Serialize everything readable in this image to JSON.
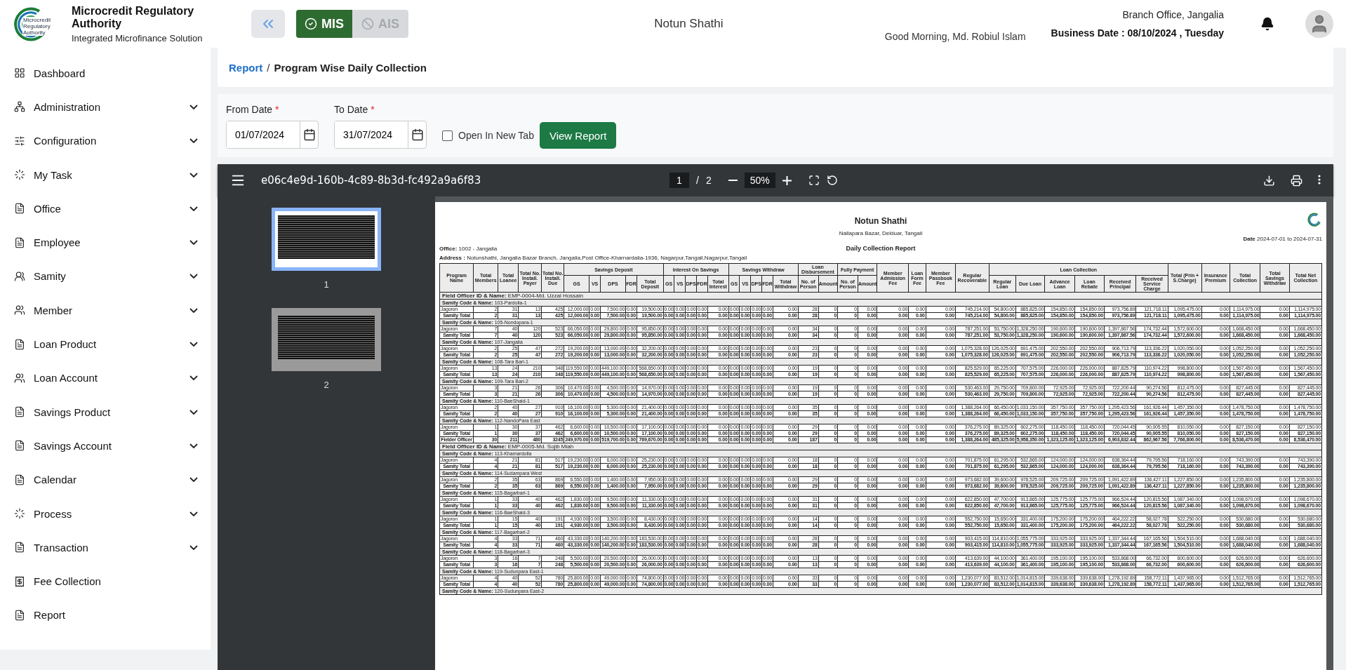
{
  "header": {
    "logo_lines": [
      "Microcredit",
      "Regulatory",
      "Authority"
    ],
    "org_name": "Microcredit Regulatory Authority",
    "org_subtitle": "Integrated Microfinance Solution",
    "modes": [
      {
        "label": "MIS",
        "selected": true
      },
      {
        "label": "AIS",
        "selected": false
      }
    ],
    "center_title": "Notun Shathi",
    "greeting": "Good Morning, Md. Robiul Islam",
    "branch": "Branch Office, Jangalia",
    "business_date": "Business Date : 08/10/2024 , Tuesday"
  },
  "sidebar": {
    "items": [
      {
        "label": "Dashboard",
        "kind": "dashboard",
        "expandable": false
      },
      {
        "label": "Administration",
        "kind": "admin",
        "expandable": true
      },
      {
        "label": "Configuration",
        "kind": "config",
        "expandable": true
      },
      {
        "label": "My Task",
        "kind": "task",
        "expandable": true
      },
      {
        "label": "Office",
        "kind": "doc",
        "expandable": true
      },
      {
        "label": "Employee",
        "kind": "doc",
        "expandable": true
      },
      {
        "label": "Samity",
        "kind": "samity",
        "expandable": true
      },
      {
        "label": "Member",
        "kind": "member",
        "expandable": true
      },
      {
        "label": "Loan Product",
        "kind": "doc",
        "expandable": true
      },
      {
        "label": "Loan Account",
        "kind": "member",
        "expandable": true
      },
      {
        "label": "Savings Product",
        "kind": "doc",
        "expandable": true
      },
      {
        "label": "Savings Account",
        "kind": "doc",
        "expandable": true
      },
      {
        "label": "Calendar",
        "kind": "doc",
        "expandable": true
      },
      {
        "label": "Process",
        "kind": "task",
        "expandable": true
      },
      {
        "label": "Transaction",
        "kind": "doc",
        "expandable": true
      },
      {
        "label": "Fee Collection",
        "kind": "fee",
        "expandable": false
      },
      {
        "label": "Report",
        "kind": "doc",
        "expandable": false
      }
    ]
  },
  "breadcrumb": {
    "link": "Report",
    "separator": "/",
    "current": "Program Wise Daily Collection"
  },
  "filters": {
    "fields": [
      {
        "label": "From Date",
        "required_mark": "*",
        "value": "01/07/2024"
      },
      {
        "label": "To Date",
        "required_mark": "*",
        "value": "31/07/2024"
      }
    ],
    "open_in_new_tab": {
      "label": "Open In New Tab",
      "checked": false
    },
    "button": "View Report"
  },
  "viewer": {
    "file_name": "e06c4e9d-160b-4c89-8b3d-fc492a9a6f83",
    "page": "1",
    "page_separator": "/",
    "page_total": "2",
    "zoom": "50%",
    "thumbnails": [
      {
        "label": "1",
        "selected": true
      },
      {
        "label": "2",
        "selected": false
      }
    ],
    "report": {
      "title": "Notun Shathi",
      "address_line": "Nallapara Bazar, Delduar, Tangail",
      "office_label": "Office:",
      "office": "1002 - Jangalia",
      "subtitle": "Daily Collection Report",
      "date_label": "Date",
      "date_range": "2024-07-01 to 2024-07-31",
      "address_label": "Address :",
      "address": "Notunshathi, Jangalia Bazar Branch, Jangalia,Post Office-Kharnardalia-1936, Nagarpur,Tangail,Nagarpur,Tangail",
      "columns": [
        {
          "label": "Program Name"
        },
        {
          "label": "Total Members"
        },
        {
          "label": "Total Loanee"
        },
        {
          "label": "Total No. Install. Payer"
        },
        {
          "label": "Total No. Install. Due"
        },
        {
          "label": "Savings Deposit",
          "children": [
            {
              "label": "GS"
            },
            {
              "label": "VS"
            },
            {
              "label": "DPS"
            },
            {
              "label": "FDR"
            },
            {
              "label": "Total Deposit"
            }
          ]
        },
        {
          "label": "Interest On Savings",
          "children": [
            {
              "label": "GS"
            },
            {
              "label": "VS"
            },
            {
              "label": "DPS"
            },
            {
              "label": "FDR"
            },
            {
              "label": "Total Interest"
            }
          ]
        },
        {
          "label": "Savings Withdraw",
          "children": [
            {
              "label": "GS"
            },
            {
              "label": "VS"
            },
            {
              "label": "DPS"
            },
            {
              "label": "FDR"
            },
            {
              "label": "Total Withdraw"
            }
          ]
        },
        {
          "label": "Loan Disbursement",
          "children": [
            {
              "label": "No. of Person"
            },
            {
              "label": "Amount"
            }
          ]
        },
        {
          "label": "Fully Payment",
          "children": [
            {
              "label": "No. of Person"
            },
            {
              "label": "Amount"
            }
          ]
        },
        {
          "label": "Member Admission Fee"
        },
        {
          "label": "Loan Form Fee"
        },
        {
          "label": "Member Passbook Fee"
        },
        {
          "label": "Regular Recoverable"
        },
        {
          "label": "Loan Collection",
          "children": [
            {
              "label": "Regular Loan"
            },
            {
              "label": "Due Loan"
            },
            {
              "label": "Advance Loan"
            },
            {
              "label": "Loan Rebate"
            },
            {
              "label": "Received Principal"
            },
            {
              "label": "Received Service Charge"
            }
          ]
        },
        {
          "label": "Total (Prin + S.Charge)"
        },
        {
          "label": "Insurance Premium"
        },
        {
          "label": "Total Collection"
        },
        {
          "label": "Total Savings Withdraw"
        },
        {
          "label": "Total Net Collection"
        }
      ],
      "rows": [
        {
          "kind": "officer",
          "label": "Field Officer ID & Name:",
          "value": "EMP-0004-Md. Uzzal Hossain"
        },
        {
          "kind": "samity",
          "label": "Samity Code & Name:",
          "value": "103-Pardolla-1"
        },
        {
          "kind": "data",
          "cells": [
            "Jagoron",
            "2",
            "31",
            "13",
            "425",
            "12,000.00",
            "0.00",
            "7,500.00",
            "0.00",
            "19,500.00",
            "0.00",
            "0.00",
            "0.00",
            "0.00",
            "0.00",
            "0.00",
            "0.00",
            "0.00",
            "0.00",
            "0.00",
            "28",
            "0",
            "0",
            "0.00",
            "0.00",
            "0.00",
            "0.00",
            "745,214.00",
            "54,800.00",
            "885,825.00",
            "154,850.00",
            "154,850.00",
            "973,756.89",
            "121,718.11",
            "1,095,475.00",
            "0.00",
            "1,114,975.00",
            "0.00",
            "1,114,975.00"
          ]
        },
        {
          "kind": "total",
          "cells": [
            "Samity Total",
            "2",
            "31",
            "13",
            "425",
            "12,000.00",
            "0.00",
            "7,500.00",
            "0.00",
            "19,500.00",
            "0.00",
            "0.00",
            "0.00",
            "0.00",
            "0.00",
            "0.00",
            "0.00",
            "0.00",
            "0.00",
            "0.00",
            "28",
            "0",
            "0",
            "0.00",
            "0.00",
            "0.00",
            "0.00",
            "745,214.00",
            "54,800.00",
            "885,825.00",
            "154,850.00",
            "154,850.00",
            "973,756.89",
            "121,718.11",
            "1,095,475.00",
            "0.00",
            "1,114,975.00",
            "0.00",
            "1,114,975.00"
          ]
        },
        {
          "kind": "samity",
          "label": "Samity Code & Name:",
          "value": "105-Nondopara-1"
        },
        {
          "kind": "data",
          "cells": [
            "Jagoron",
            "7",
            "40",
            "120",
            "523",
            "66,050.00",
            "0.00",
            "29,800.00",
            "0.00",
            "95,850.00",
            "0.00",
            "0.00",
            "0.00",
            "0.00",
            "0.00",
            "0.00",
            "0.00",
            "0.00",
            "0.00",
            "0.00",
            "34",
            "0",
            "0",
            "0.00",
            "0.00",
            "0.00",
            "0.00",
            "787,251.00",
            "53,750.00",
            "1,328,250.00",
            "190,600.00",
            "190,600.00",
            "1,397,867.56",
            "174,732.44",
            "1,572,600.00",
            "0.00",
            "1,668,450.00",
            "0.00",
            "1,668,450.00"
          ]
        },
        {
          "kind": "total",
          "cells": [
            "Samity Total",
            "7",
            "40",
            "120",
            "523",
            "66,050.00",
            "0.00",
            "29,800.00",
            "0.00",
            "95,850.00",
            "0.00",
            "0.00",
            "0.00",
            "0.00",
            "0.00",
            "0.00",
            "0.00",
            "0.00",
            "0.00",
            "0.00",
            "34",
            "0",
            "0",
            "0.00",
            "0.00",
            "0.00",
            "0.00",
            "787,251.00",
            "53,750.00",
            "1,328,250.00",
            "190,600.00",
            "190,600.00",
            "1,397,867.56",
            "174,732.44",
            "1,572,600.00",
            "0.00",
            "1,668,450.00",
            "0.00",
            "1,668,450.00"
          ]
        },
        {
          "kind": "samity",
          "label": "Samity Code & Name:",
          "value": "107-Jangalia"
        },
        {
          "kind": "data",
          "cells": [
            "Jagoron",
            "2",
            "25",
            "47",
            "272",
            "19,200.00",
            "0.00",
            "13,000.00",
            "0.00",
            "32,200.00",
            "0.00",
            "0.00",
            "0.00",
            "0.00",
            "0.00",
            "0.00",
            "0.00",
            "0.00",
            "0.00",
            "0.00",
            "23",
            "0",
            "0",
            "0.00",
            "0.00",
            "0.00",
            "0.00",
            "1,075,328.00",
            "126,025.00",
            "691,475.00",
            "202,550.00",
            "202,550.00",
            "906,713.79",
            "113,336.22",
            "1,020,050.00",
            "0.00",
            "1,052,250.00",
            "0.00",
            "1,052,250.00"
          ]
        },
        {
          "kind": "total",
          "cells": [
            "Samity Total",
            "2",
            "25",
            "47",
            "272",
            "19,200.00",
            "0.00",
            "13,000.00",
            "0.00",
            "32,200.00",
            "0.00",
            "0.00",
            "0.00",
            "0.00",
            "0.00",
            "0.00",
            "0.00",
            "0.00",
            "0.00",
            "0.00",
            "23",
            "0",
            "0",
            "0.00",
            "0.00",
            "0.00",
            "0.00",
            "1,075,328.00",
            "126,025.00",
            "691,475.00",
            "202,550.00",
            "202,550.00",
            "906,713.79",
            "113,336.22",
            "1,020,050.00",
            "0.00",
            "1,052,250.00",
            "0.00",
            "1,052,250.00"
          ]
        },
        {
          "kind": "samity",
          "label": "Samity Code & Name:",
          "value": "108-Tara Bari-1"
        },
        {
          "kind": "data",
          "cells": [
            "Jagoron",
            "13",
            "24",
            "210",
            "348",
            "119,550.00",
            "0.00",
            "449,100.00",
            "0.00",
            "568,650.00",
            "0.00",
            "0.00",
            "0.00",
            "0.00",
            "0.00",
            "0.00",
            "0.00",
            "0.00",
            "0.00",
            "0.00",
            "19",
            "0",
            "0",
            "0.00",
            "0.00",
            "0.00",
            "0.00",
            "825,529.00",
            "65,225.00",
            "707,575.00",
            "226,000.00",
            "226,000.00",
            "887,825.79",
            "110,974.22",
            "998,800.00",
            "0.00",
            "1,567,450.00",
            "0.00",
            "1,567,450.00"
          ]
        },
        {
          "kind": "total",
          "cells": [
            "Samity Total",
            "13",
            "24",
            "210",
            "348",
            "119,550.00",
            "0.00",
            "449,100.00",
            "0.00",
            "568,650.00",
            "0.00",
            "0.00",
            "0.00",
            "0.00",
            "0.00",
            "0.00",
            "0.00",
            "0.00",
            "0.00",
            "0.00",
            "19",
            "0",
            "0",
            "0.00",
            "0.00",
            "0.00",
            "0.00",
            "825,529.00",
            "65,225.00",
            "707,575.00",
            "226,000.00",
            "226,000.00",
            "887,825.79",
            "110,974.22",
            "998,800.00",
            "0.00",
            "1,567,450.00",
            "0.00",
            "1,567,450.00"
          ]
        },
        {
          "kind": "samity",
          "label": "Samity Code & Name:",
          "value": "109-Tara Bari-2"
        },
        {
          "kind": "data",
          "cells": [
            "Jagoron",
            "3",
            "21",
            "26",
            "306",
            "10,470.00",
            "0.00",
            "4,500.00",
            "0.00",
            "14,970.00",
            "0.00",
            "0.00",
            "0.00",
            "0.00",
            "0.00",
            "0.00",
            "0.00",
            "0.00",
            "0.00",
            "0.00",
            "19",
            "0",
            "0",
            "0.00",
            "0.00",
            "0.00",
            "0.00",
            "530,463.00",
            "29,750.00",
            "709,800.00",
            "72,925.00",
            "72,925.00",
            "722,200.44",
            "90,274.56",
            "812,475.00",
            "0.00",
            "827,445.00",
            "0.00",
            "827,445.00"
          ]
        },
        {
          "kind": "total",
          "cells": [
            "Samity Total",
            "3",
            "21",
            "26",
            "306",
            "10,470.00",
            "0.00",
            "4,500.00",
            "0.00",
            "14,970.00",
            "0.00",
            "0.00",
            "0.00",
            "0.00",
            "0.00",
            "0.00",
            "0.00",
            "0.00",
            "0.00",
            "0.00",
            "19",
            "0",
            "0",
            "0.00",
            "0.00",
            "0.00",
            "0.00",
            "530,463.00",
            "29,750.00",
            "709,800.00",
            "72,925.00",
            "72,925.00",
            "722,200.44",
            "90,274.56",
            "812,475.00",
            "0.00",
            "827,445.00",
            "0.00",
            "827,445.00"
          ]
        },
        {
          "kind": "samity",
          "label": "Samity Code & Name:",
          "value": "110-BaeShaid-1"
        },
        {
          "kind": "data",
          "cells": [
            "Jagoron",
            "2",
            "40",
            "27",
            "910",
            "16,100.00",
            "0.00",
            "5,300.00",
            "0.00",
            "21,400.00",
            "0.00",
            "0.00",
            "0.00",
            "0.00",
            "0.00",
            "0.00",
            "0.00",
            "0.00",
            "0.00",
            "0.00",
            "35",
            "0",
            "0",
            "0.00",
            "0.00",
            "0.00",
            "0.00",
            "1,388,264.00",
            "66,450.00",
            "1,033,150.00",
            "357,750.00",
            "357,750.00",
            "1,295,423.56",
            "161,926.44",
            "1,457,350.00",
            "0.00",
            "1,478,750.00",
            "0.00",
            "1,478,750.00"
          ]
        },
        {
          "kind": "total",
          "cells": [
            "Samity Total",
            "2",
            "40",
            "27",
            "910",
            "16,100.00",
            "0.00",
            "5,300.00",
            "0.00",
            "21,400.00",
            "0.00",
            "0.00",
            "0.00",
            "0.00",
            "0.00",
            "0.00",
            "0.00",
            "0.00",
            "0.00",
            "0.00",
            "35",
            "0",
            "0",
            "0.00",
            "0.00",
            "0.00",
            "0.00",
            "1,388,264.00",
            "66,450.00",
            "1,033,150.00",
            "357,750.00",
            "357,750.00",
            "1,295,423.56",
            "161,926.44",
            "1,457,350.00",
            "0.00",
            "1,478,750.00",
            "0.00",
            "1,478,750.00"
          ]
        },
        {
          "kind": "samity",
          "label": "Samity Code & Name:",
          "value": "112-NandoPara East"
        },
        {
          "kind": "data",
          "cells": [
            "Jagoron",
            "1",
            "30",
            "37",
            "462",
            "6,600.00",
            "0.00",
            "10,500.00",
            "0.00",
            "17,100.00",
            "0.00",
            "0.00",
            "0.00",
            "0.00",
            "0.00",
            "0.00",
            "0.00",
            "0.00",
            "0.00",
            "0.00",
            "29",
            "0",
            "0",
            "0.00",
            "0.00",
            "0.00",
            "0.00",
            "376,275.00",
            "89,325.00",
            "602,275.00",
            "118,450.00",
            "118,450.00",
            "720,044.45",
            "90,005.55",
            "810,050.00",
            "0.00",
            "827,150.00",
            "0.00",
            "827,150.00"
          ]
        },
        {
          "kind": "total",
          "cells": [
            "Samity Total",
            "1",
            "30",
            "37",
            "462",
            "6,600.00",
            "0.00",
            "10,500.00",
            "0.00",
            "17,100.00",
            "0.00",
            "0.00",
            "0.00",
            "0.00",
            "0.00",
            "0.00",
            "0.00",
            "0.00",
            "0.00",
            "0.00",
            "29",
            "0",
            "0",
            "0.00",
            "0.00",
            "0.00",
            "0.00",
            "376,275.00",
            "89,325.00",
            "602,275.00",
            "118,450.00",
            "118,450.00",
            "720,044.45",
            "90,005.55",
            "810,050.00",
            "0.00",
            "827,150.00",
            "0.00",
            "827,150.00"
          ]
        },
        {
          "kind": "total",
          "cells": [
            "Fielder Officer",
            "30",
            "211",
            "480",
            "3245",
            "249,970.00",
            "0.00",
            "519,700.00",
            "0.00",
            "769,670.00",
            "0.00",
            "0.00",
            "0.00",
            "0.00",
            "0.00",
            "0.00",
            "0.00",
            "0.00",
            "0.00",
            "0.00",
            "187",
            "0",
            "0",
            "0.00",
            "0.00",
            "0.00",
            "0.00",
            "1,388,264.00",
            "485,325.00",
            "5,958,350.00",
            "1,323,125.00",
            "1,323,125.00",
            "6,903,832.44",
            "862,967.56",
            "7,766,800.00",
            "0.00",
            "8,536,470.00",
            "0.00",
            "8,536,470.00"
          ]
        },
        {
          "kind": "officer",
          "label": "Field Officer ID & Name:",
          "value": "EMP-0005-Md. Sojib Miah"
        },
        {
          "kind": "samity",
          "label": "Samity Code & Name:",
          "value": "113-Khamardolla"
        },
        {
          "kind": "data",
          "cells": [
            "Jagoron",
            "4",
            "21",
            "81",
            "517",
            "19,230.00",
            "0.00",
            "6,000.00",
            "0.00",
            "25,230.00",
            "0.00",
            "0.00",
            "0.00",
            "0.00",
            "0.00",
            "0.00",
            "0.00",
            "0.00",
            "0.00",
            "0.00",
            "18",
            "0",
            "0",
            "0.00",
            "0.00",
            "0.00",
            "0.00",
            "701,875.00",
            "61,295.00",
            "532,865.00",
            "124,000.00",
            "124,000.00",
            "638,364.44",
            "79,795.56",
            "718,160.00",
            "0.00",
            "743,390.00",
            "0.00",
            "743,390.00"
          ]
        },
        {
          "kind": "total",
          "cells": [
            "Samity Total",
            "4",
            "21",
            "81",
            "517",
            "19,230.00",
            "0.00",
            "6,000.00",
            "0.00",
            "25,230.00",
            "0.00",
            "0.00",
            "0.00",
            "0.00",
            "0.00",
            "0.00",
            "0.00",
            "0.00",
            "0.00",
            "0.00",
            "18",
            "0",
            "0",
            "0.00",
            "0.00",
            "0.00",
            "0.00",
            "701,875.00",
            "61,295.00",
            "532,865.00",
            "124,000.00",
            "124,000.00",
            "638,364.44",
            "79,795.56",
            "718,160.00",
            "0.00",
            "743,390.00",
            "0.00",
            "743,390.00"
          ]
        },
        {
          "kind": "samity",
          "label": "Samity Code & Name:",
          "value": "114-Sudampara West"
        },
        {
          "kind": "data",
          "cells": [
            "Jagoron",
            "2",
            "35",
            "63",
            "869",
            "6,550.00",
            "0.00",
            "1,400.00",
            "0.00",
            "7,950.00",
            "0.00",
            "0.00",
            "0.00",
            "0.00",
            "0.00",
            "0.00",
            "0.00",
            "0.00",
            "0.00",
            "0.00",
            "29",
            "0",
            "0",
            "0.00",
            "0.00",
            "0.00",
            "0.00",
            "973,682.00",
            "39,600.00",
            "978,525.00",
            "209,725.00",
            "209,725.00",
            "1,091,422.89",
            "136,427.11",
            "1,227,850.00",
            "0.00",
            "1,235,800.00",
            "0.00",
            "1,235,800.00"
          ]
        },
        {
          "kind": "total",
          "cells": [
            "Samity Total",
            "2",
            "35",
            "63",
            "869",
            "6,550.00",
            "0.00",
            "1,400.00",
            "0.00",
            "7,950.00",
            "0.00",
            "0.00",
            "0.00",
            "0.00",
            "0.00",
            "0.00",
            "0.00",
            "0.00",
            "0.00",
            "0.00",
            "29",
            "0",
            "0",
            "0.00",
            "0.00",
            "0.00",
            "0.00",
            "973,682.00",
            "39,600.00",
            "978,525.00",
            "209,725.00",
            "209,725.00",
            "1,091,422.89",
            "136,427.11",
            "1,227,850.00",
            "0.00",
            "1,235,800.00",
            "0.00",
            "1,235,800.00"
          ]
        },
        {
          "kind": "samity",
          "label": "Samity Code & Name:",
          "value": "115-Bagarbari-1"
        },
        {
          "kind": "data",
          "cells": [
            "Jagoron",
            "1",
            "33",
            "40",
            "462",
            "1,830.00",
            "0.00",
            "9,500.00",
            "0.00",
            "11,330.00",
            "0.00",
            "0.00",
            "0.00",
            "0.00",
            "0.00",
            "0.00",
            "0.00",
            "0.00",
            "0.00",
            "0.00",
            "31",
            "0",
            "0",
            "0.00",
            "0.00",
            "0.00",
            "0.00",
            "622,850.00",
            "47,700.00",
            "913,865.00",
            "125,775.00",
            "125,775.00",
            "966,524.44",
            "120,815.56",
            "1,087,340.00",
            "0.00",
            "1,098,670.00",
            "0.00",
            "1,098,670.00"
          ]
        },
        {
          "kind": "total",
          "cells": [
            "Samity Total",
            "1",
            "33",
            "40",
            "462",
            "1,830.00",
            "0.00",
            "9,500.00",
            "0.00",
            "11,330.00",
            "0.00",
            "0.00",
            "0.00",
            "0.00",
            "0.00",
            "0.00",
            "0.00",
            "0.00",
            "0.00",
            "0.00",
            "31",
            "0",
            "0",
            "0.00",
            "0.00",
            "0.00",
            "0.00",
            "622,850.00",
            "47,700.00",
            "913,865.00",
            "125,775.00",
            "125,775.00",
            "966,524.44",
            "120,815.56",
            "1,087,340.00",
            "0.00",
            "1,098,670.00",
            "0.00",
            "1,098,670.00"
          ]
        },
        {
          "kind": "samity",
          "label": "Samity Code & Name:",
          "value": "116-BaeShaid-3"
        },
        {
          "kind": "data",
          "cells": [
            "Jagoron",
            "1",
            "15",
            "40",
            "191",
            "4,930.00",
            "0.00",
            "3,500.00",
            "0.00",
            "8,430.00",
            "0.00",
            "0.00",
            "0.00",
            "0.00",
            "0.00",
            "0.00",
            "0.00",
            "0.00",
            "0.00",
            "0.00",
            "14",
            "0",
            "0",
            "0.00",
            "0.00",
            "0.00",
            "0.00",
            "552,750.00",
            "15,650.00",
            "331,400.00",
            "175,200.00",
            "175,200.00",
            "464,222.22",
            "58,027.78",
            "522,250.00",
            "0.00",
            "530,680.00",
            "0.00",
            "530,680.00"
          ]
        },
        {
          "kind": "total",
          "cells": [
            "Samity Total",
            "1",
            "15",
            "40",
            "191",
            "4,930.00",
            "0.00",
            "3,500.00",
            "0.00",
            "8,430.00",
            "0.00",
            "0.00",
            "0.00",
            "0.00",
            "0.00",
            "0.00",
            "0.00",
            "0.00",
            "0.00",
            "0.00",
            "14",
            "0",
            "0",
            "0.00",
            "0.00",
            "0.00",
            "0.00",
            "552,750.00",
            "15,650.00",
            "331,400.00",
            "175,200.00",
            "175,200.00",
            "464,222.22",
            "58,027.78",
            "522,250.00",
            "0.00",
            "530,680.00",
            "0.00",
            "530,680.00"
          ]
        },
        {
          "kind": "samity",
          "label": "Samity Code & Name:",
          "value": "117-Bagarbari-2"
        },
        {
          "kind": "data",
          "cells": [
            "Jagoron",
            "4",
            "33",
            "71",
            "460",
            "43,330.00",
            "0.00",
            "140,200.00",
            "0.00",
            "183,530.00",
            "0.00",
            "0.00",
            "0.00",
            "0.00",
            "0.00",
            "0.00",
            "0.00",
            "0.00",
            "0.00",
            "0.00",
            "28",
            "0",
            "0",
            "0.00",
            "0.00",
            "0.00",
            "0.00",
            "903,415.00",
            "114,810.00",
            "1,055,775.00",
            "333,925.00",
            "333,925.00",
            "1,337,344.44",
            "167,165.56",
            "1,504,510.00",
            "0.00",
            "1,688,040.00",
            "0.00",
            "1,688,040.00"
          ]
        },
        {
          "kind": "total",
          "cells": [
            "Samity Total",
            "4",
            "33",
            "71",
            "460",
            "43,330.00",
            "0.00",
            "140,200.00",
            "0.00",
            "183,530.00",
            "0.00",
            "0.00",
            "0.00",
            "0.00",
            "0.00",
            "0.00",
            "0.00",
            "0.00",
            "0.00",
            "0.00",
            "28",
            "0",
            "0",
            "0.00",
            "0.00",
            "0.00",
            "0.00",
            "903,415.00",
            "114,810.00",
            "1,055,775.00",
            "333,925.00",
            "333,925.00",
            "1,337,344.44",
            "167,165.56",
            "1,504,510.00",
            "0.00",
            "1,688,040.00",
            "0.00",
            "1,688,040.00"
          ]
        },
        {
          "kind": "samity",
          "label": "Samity Code & Name:",
          "value": "118-Bagarbari-3"
        },
        {
          "kind": "data",
          "cells": [
            "Jagoron",
            "3",
            "16",
            "7",
            "248",
            "5,500.00",
            "0.00",
            "20,500.00",
            "0.00",
            "26,000.00",
            "0.00",
            "0.00",
            "0.00",
            "0.00",
            "0.00",
            "0.00",
            "0.00",
            "0.00",
            "0.00",
            "0.00",
            "13",
            "0",
            "0",
            "0.00",
            "0.00",
            "0.00",
            "0.00",
            "413,639.00",
            "44,100.00",
            "361,400.00",
            "195,100.00",
            "195,100.00",
            "533,868.00",
            "66,732.00",
            "600,600.00",
            "0.00",
            "626,600.00",
            "0.00",
            "626,600.00"
          ]
        },
        {
          "kind": "total",
          "cells": [
            "Samity Total",
            "3",
            "16",
            "7",
            "248",
            "5,500.00",
            "0.00",
            "20,500.00",
            "0.00",
            "26,000.00",
            "0.00",
            "0.00",
            "0.00",
            "0.00",
            "0.00",
            "0.00",
            "0.00",
            "0.00",
            "0.00",
            "0.00",
            "13",
            "0",
            "0",
            "0.00",
            "0.00",
            "0.00",
            "0.00",
            "413,639.00",
            "44,100.00",
            "361,400.00",
            "195,100.00",
            "195,100.00",
            "533,868.00",
            "66,732.00",
            "600,600.00",
            "0.00",
            "626,600.00",
            "0.00",
            "626,600.00"
          ]
        },
        {
          "kind": "samity",
          "label": "Samity Code & Name:",
          "value": "119-Sudunpara East-1"
        },
        {
          "kind": "data",
          "cells": [
            "Jagoron",
            "4",
            "40",
            "52",
            "780",
            "25,800.00",
            "0.00",
            "49,000.00",
            "0.00",
            "74,800.00",
            "0.00",
            "0.00",
            "0.00",
            "0.00",
            "0.00",
            "0.00",
            "0.00",
            "0.00",
            "0.00",
            "0.00",
            "33",
            "0",
            "0",
            "0.00",
            "0.00",
            "0.00",
            "0.00",
            "1,230,077.00",
            "83,512.00",
            "1,014,815.00",
            "339,638.00",
            "339,638.00",
            "1,278,192.89",
            "158,772.11",
            "1,437,965.00",
            "0.00",
            "1,512,765.00",
            "0.00",
            "1,512,765.00"
          ]
        },
        {
          "kind": "total",
          "cells": [
            "Samity Total",
            "4",
            "40",
            "52",
            "780",
            "25,800.00",
            "0.00",
            "49,000.00",
            "0.00",
            "74,800.00",
            "0.00",
            "0.00",
            "0.00",
            "0.00",
            "0.00",
            "0.00",
            "0.00",
            "0.00",
            "0.00",
            "0.00",
            "33",
            "0",
            "0",
            "0.00",
            "0.00",
            "0.00",
            "0.00",
            "1,230,077.00",
            "83,512.00",
            "1,014,815.00",
            "339,638.00",
            "339,638.00",
            "1,278,192.89",
            "158,772.11",
            "1,437,965.00",
            "0.00",
            "1,512,765.00",
            "0.00",
            "1,512,765.00"
          ]
        },
        {
          "kind": "samity",
          "label": "Samity Code & Name:",
          "value": "120-Sudunpara East-2"
        }
      ]
    }
  }
}
